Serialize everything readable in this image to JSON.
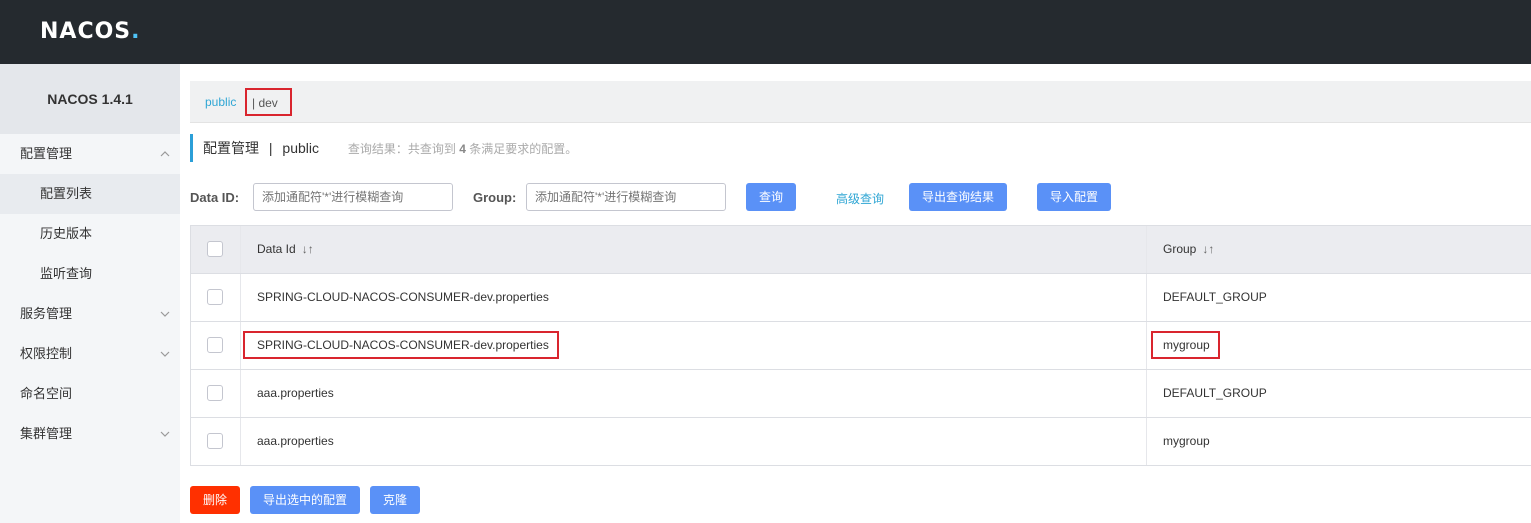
{
  "header": {
    "logo": "NACOS",
    "logo_dot": "."
  },
  "sidebar": {
    "version": "NACOS 1.4.1",
    "items": [
      {
        "label": "配置管理"
      },
      {
        "label": "配置列表"
      },
      {
        "label": "历史版本"
      },
      {
        "label": "监听查询"
      },
      {
        "label": "服务管理"
      },
      {
        "label": "权限控制"
      },
      {
        "label": "命名空间"
      },
      {
        "label": "集群管理"
      }
    ]
  },
  "namespaces": {
    "public": "public",
    "dev": "| dev"
  },
  "page": {
    "title": "配置管理",
    "separator": "|",
    "namespace": "public",
    "result_prefix": "查询结果：共查询到",
    "result_count": "4",
    "result_suffix": "条满足要求的配置。"
  },
  "search": {
    "dataid_label": "Data ID:",
    "dataid_placeholder": "添加通配符'*'进行模糊查询",
    "group_label": "Group:",
    "group_placeholder": "添加通配符'*'进行模糊查询",
    "query_btn": "查询",
    "advanced_link": "高级查询",
    "export_btn": "导出查询结果",
    "import_btn": "导入配置"
  },
  "table": {
    "columns": {
      "data_id": "Data Id",
      "group": "Group",
      "sort_icon": "↓↑"
    },
    "rows": [
      {
        "data_id": "SPRING-CLOUD-NACOS-CONSUMER-dev.properties",
        "group": "DEFAULT_GROUP"
      },
      {
        "data_id": "SPRING-CLOUD-NACOS-CONSUMER-dev.properties",
        "group": "mygroup"
      },
      {
        "data_id": "aaa.properties",
        "group": "DEFAULT_GROUP"
      },
      {
        "data_id": "aaa.properties",
        "group": "mygroup"
      }
    ]
  },
  "footer": {
    "delete_btn": "删除",
    "export_selected_btn": "导出选中的配置",
    "clone_btn": "克隆"
  },
  "colors": {
    "header_bg": "#252a2f",
    "primary": "#5a91f7",
    "danger": "#ff3000",
    "link": "#2fa6d4",
    "highlight_border": "#d9252e"
  }
}
